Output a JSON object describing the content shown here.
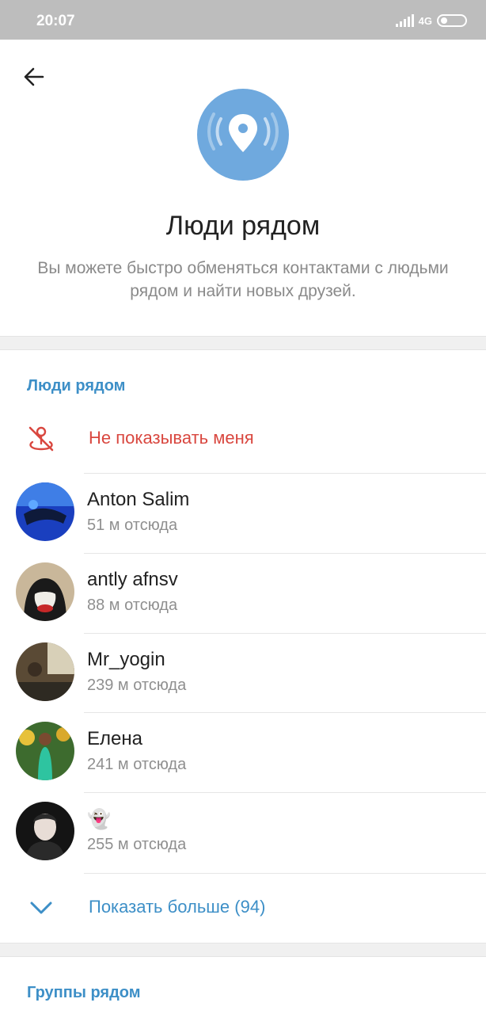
{
  "status_bar": {
    "time": "20:07",
    "network": "4G"
  },
  "header": {
    "title": "Люди рядом",
    "description": "Вы можете быстро обменяться контактами с людьми рядом и найти новых друзей."
  },
  "people_section": {
    "title": "Люди рядом",
    "hide_me_label": "Не показывать меня",
    "people": [
      {
        "name": "Anton Salim",
        "distance": "51 м отсюда"
      },
      {
        "name": "antly afnsv",
        "distance": "88 м отсюда"
      },
      {
        "name": "Mr_yogin",
        "distance": "239 м отсюда"
      },
      {
        "name": "Елена",
        "distance": "241 м отсюда"
      },
      {
        "name": "👻",
        "distance": "255 м отсюда"
      }
    ],
    "show_more_label": "Показать больше (94)"
  },
  "groups_section": {
    "title": "Группы рядом"
  },
  "colors": {
    "accent": "#3d8fc7",
    "danger": "#d9473f",
    "hero": "#6fa9de",
    "status_bar": "#bdbdbd"
  }
}
